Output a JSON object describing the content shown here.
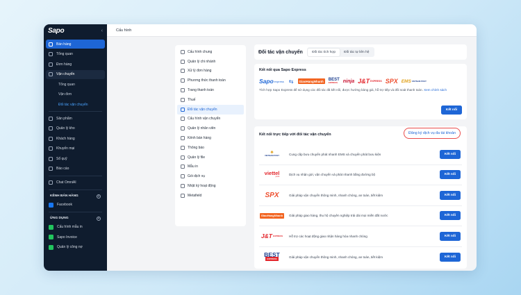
{
  "brand": {
    "logo": "Sapo",
    "collapse_icon": "chevron-left-icon"
  },
  "sidebar": {
    "items": [
      {
        "label": "Bán hàng",
        "icon": "store-icon",
        "state": "active"
      },
      {
        "label": "Tổng quan",
        "icon": "home-icon"
      },
      {
        "label": "Đơn hàng",
        "icon": "orders-icon"
      },
      {
        "label": "Vận chuyển",
        "icon": "truck-icon",
        "state": "open"
      }
    ],
    "sub_items": [
      {
        "label": "Tổng quan"
      },
      {
        "label": "Vận đơn"
      },
      {
        "label": "Đối tác vận chuyển",
        "current": true
      }
    ],
    "items2": [
      {
        "label": "Sản phẩm",
        "icon": "box-icon"
      },
      {
        "label": "Quản lý kho",
        "icon": "warehouse-icon"
      },
      {
        "label": "Khách hàng",
        "icon": "customers-icon"
      },
      {
        "label": "Khuyến mại",
        "icon": "promotion-icon"
      },
      {
        "label": "Sổ quỹ",
        "icon": "cashbook-icon"
      },
      {
        "label": "Báo cáo",
        "icon": "report-icon"
      }
    ],
    "chat": {
      "label": "Chat OmniAI",
      "icon": "chat-icon"
    },
    "channels_heading": "KÊNH BÁN HÀNG",
    "channels": [
      {
        "label": "Facebook",
        "icon": "facebook-icon",
        "color": "#1877f2"
      }
    ],
    "apps_heading": "ỨNG DỤNG",
    "apps": [
      {
        "label": "Cấu hình mẫu in",
        "icon": "print-icon",
        "color": "#22c55e"
      },
      {
        "label": "Sapo Invoice",
        "icon": "invoice-icon",
        "color": "#22c55e"
      },
      {
        "label": "Quản lý công nợ",
        "icon": "debt-icon",
        "color": "#22c55e"
      }
    ]
  },
  "topbar": {
    "title": "Cấu hình"
  },
  "settings_menu": [
    {
      "label": "Cấu hình chung",
      "icon": "settings-icon"
    },
    {
      "label": "Quản lý chi nhánh",
      "icon": "branch-icon"
    },
    {
      "label": "Xử lý đơn hàng",
      "icon": "order-process-icon"
    },
    {
      "label": "Phương thức thanh toán",
      "icon": "payment-method-icon"
    },
    {
      "label": "Trang thanh toán",
      "icon": "checkout-page-icon"
    },
    {
      "label": "Thuế",
      "icon": "tax-icon"
    },
    {
      "label": "Đối tác vận chuyển",
      "icon": "truck-icon",
      "active": true
    },
    {
      "label": "Cấu hình vận chuyển",
      "icon": "shipping-config-icon"
    },
    {
      "label": "Quản lý nhân viên",
      "icon": "staff-icon"
    },
    {
      "label": "Kênh bán hàng",
      "icon": "sales-channel-icon"
    },
    {
      "label": "Thông báo",
      "icon": "bell-icon"
    },
    {
      "label": "Quản lý file",
      "icon": "file-icon"
    },
    {
      "label": "Mẫu in",
      "icon": "print-template-icon"
    },
    {
      "label": "Gói dịch vụ",
      "icon": "package-icon"
    },
    {
      "label": "Nhật ký hoạt động",
      "icon": "activity-log-icon"
    },
    {
      "label": "Metafield",
      "icon": "metafield-icon"
    }
  ],
  "header": {
    "title": "Đối tác vận chuyển",
    "tabs": [
      {
        "label": "Đối tác tích hợp",
        "active": true
      },
      {
        "label": "Đối tác tự liên hệ"
      }
    ]
  },
  "express": {
    "title": "Kết nối qua Sapo Express",
    "logos": {
      "sapo": "Sapo",
      "sapo_suffix": "express",
      "ghn": "GiaoHangNhanh",
      "best": "BEST",
      "best_sub": "EXPRESS",
      "ninja": "ninja",
      "jt": "J&T",
      "jt_suffix": "EXPRESS",
      "spx": "SPX",
      "ems": "EMS",
      "ems_suffix": "VIETNAM POST"
    },
    "description": "Tích hợp Sapo Express để sử dụng các đối tác đã kết nối, được hưởng bảng giá, hỗ trợ tiếp và đối soát thanh toán.",
    "policy_link": "Xem chính sách",
    "connect_label": "Kết nối"
  },
  "direct": {
    "title": "Kết nối trực tiếp với đối tác vận chuyển",
    "register_link": "Đăng ký dịch vụ đa tài khoản",
    "connect_label": "Kết nối",
    "carriers": [
      {
        "name": "vnpost",
        "logo": "VIETNAM POST",
        "description": "Cung cấp bưu chuyển phát nhanh EMS và chuyển phát bưu kiện",
        "color": "#e0a11b"
      },
      {
        "name": "viettel",
        "logo": "viettel",
        "logo_sub": "post",
        "description": "Dịch vụ nhận gửi, vận chuyển và phát nhanh bằng đường bộ",
        "color": "#e3262c"
      },
      {
        "name": "spx",
        "logo": "SPX",
        "description": "Giải pháp vận chuyển thông minh, nhanh chóng, an toàn, tiết kiệm",
        "color": "#ee4d2d"
      },
      {
        "name": "ghn",
        "logo": "GiaoHangNhanh",
        "description": "Giải pháp giao hàng, thu hộ chuyên nghiệp trải dài mọi miền đất nước",
        "color": "#f26522"
      },
      {
        "name": "jt",
        "logo": "J&T",
        "logo_sub": "EXPRESS",
        "description": "Hỗ trợ các hoạt động giao nhận hàng hóa nhanh chóng",
        "color": "#e3262c"
      },
      {
        "name": "best",
        "logo": "BEST",
        "logo_sub": "EXPRESS",
        "description": "Giải pháp vận chuyển thông minh, nhanh chóng, an toàn, tiết kiệm",
        "color": "#1d3f8f"
      }
    ]
  }
}
